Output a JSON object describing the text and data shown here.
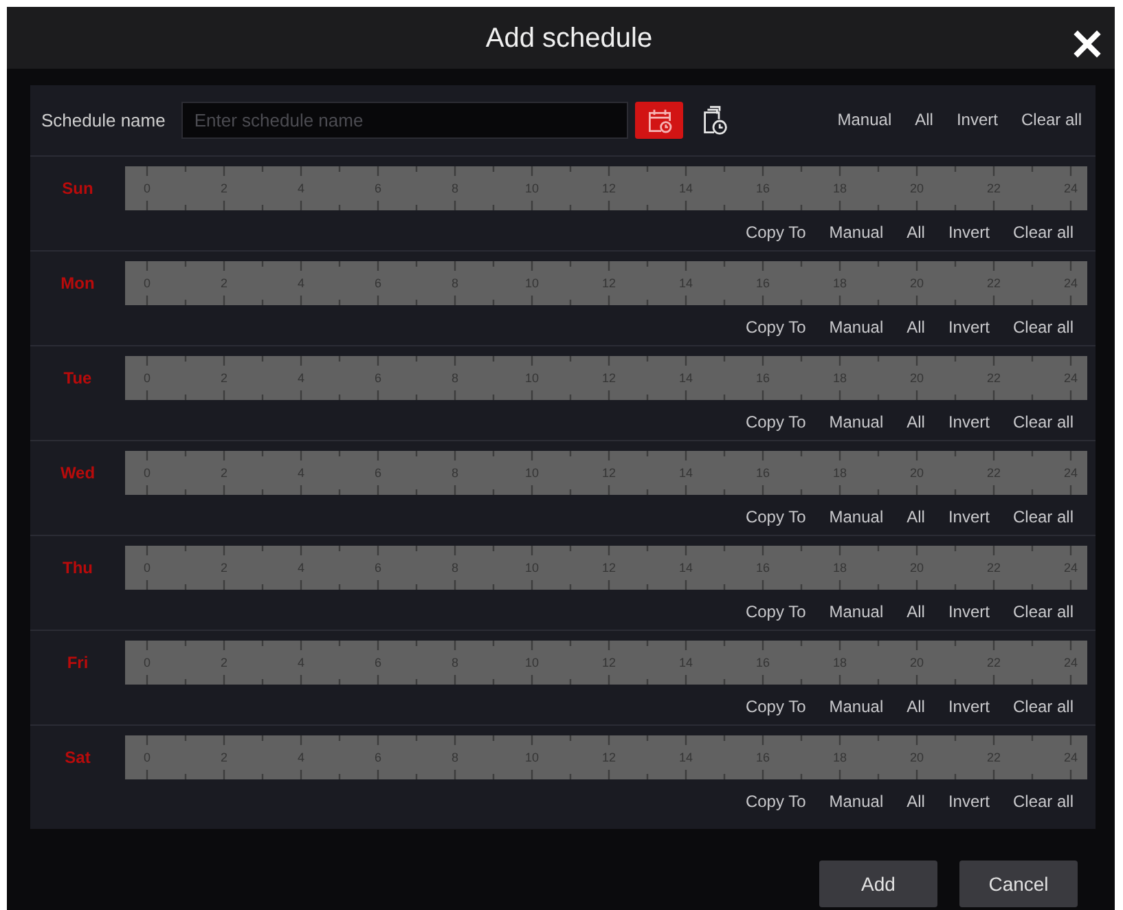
{
  "window": {
    "title": "Add schedule"
  },
  "schedule_name": {
    "label": "Schedule name",
    "placeholder": "Enter schedule name"
  },
  "tools": [
    {
      "kind": "calendar",
      "selected": true
    },
    {
      "kind": "document-clock",
      "selected": false
    }
  ],
  "toolbar_actions": [
    "Manual",
    "All",
    "Invert",
    "Clear all"
  ],
  "days": [
    {
      "label": "Sun",
      "hour_labels": [
        "0",
        "2",
        "4",
        "6",
        "8",
        "10",
        "12",
        "14",
        "16",
        "18",
        "20",
        "22",
        "24"
      ],
      "actions": [
        "Copy To",
        "Manual",
        "All",
        "Invert",
        "Clear all"
      ]
    },
    {
      "label": "Mon",
      "hour_labels": [
        "0",
        "2",
        "4",
        "6",
        "8",
        "10",
        "12",
        "14",
        "16",
        "18",
        "20",
        "22",
        "24"
      ],
      "actions": [
        "Copy To",
        "Manual",
        "All",
        "Invert",
        "Clear all"
      ]
    },
    {
      "label": "Tue",
      "hour_labels": [
        "0",
        "2",
        "4",
        "6",
        "8",
        "10",
        "12",
        "14",
        "16",
        "18",
        "20",
        "22",
        "24"
      ],
      "actions": [
        "Copy To",
        "Manual",
        "All",
        "Invert",
        "Clear all"
      ]
    },
    {
      "label": "Wed",
      "hour_labels": [
        "0",
        "2",
        "4",
        "6",
        "8",
        "10",
        "12",
        "14",
        "16",
        "18",
        "20",
        "22",
        "24"
      ],
      "actions": [
        "Copy To",
        "Manual",
        "All",
        "Invert",
        "Clear all"
      ]
    },
    {
      "label": "Thu",
      "hour_labels": [
        "0",
        "2",
        "4",
        "6",
        "8",
        "10",
        "12",
        "14",
        "16",
        "18",
        "20",
        "22",
        "24"
      ],
      "actions": [
        "Copy To",
        "Manual",
        "All",
        "Invert",
        "Clear all"
      ]
    },
    {
      "label": "Fri",
      "hour_labels": [
        "0",
        "2",
        "4",
        "6",
        "8",
        "10",
        "12",
        "14",
        "16",
        "18",
        "20",
        "22",
        "24"
      ],
      "actions": [
        "Copy To",
        "Manual",
        "All",
        "Invert",
        "Clear all"
      ]
    },
    {
      "label": "Sat",
      "hour_labels": [
        "0",
        "2",
        "4",
        "6",
        "8",
        "10",
        "12",
        "14",
        "16",
        "18",
        "20",
        "22",
        "24"
      ],
      "actions": [
        "Copy To",
        "Manual",
        "All",
        "Invert",
        "Clear all"
      ]
    }
  ],
  "buttons": [
    "Add",
    "Cancel"
  ]
}
